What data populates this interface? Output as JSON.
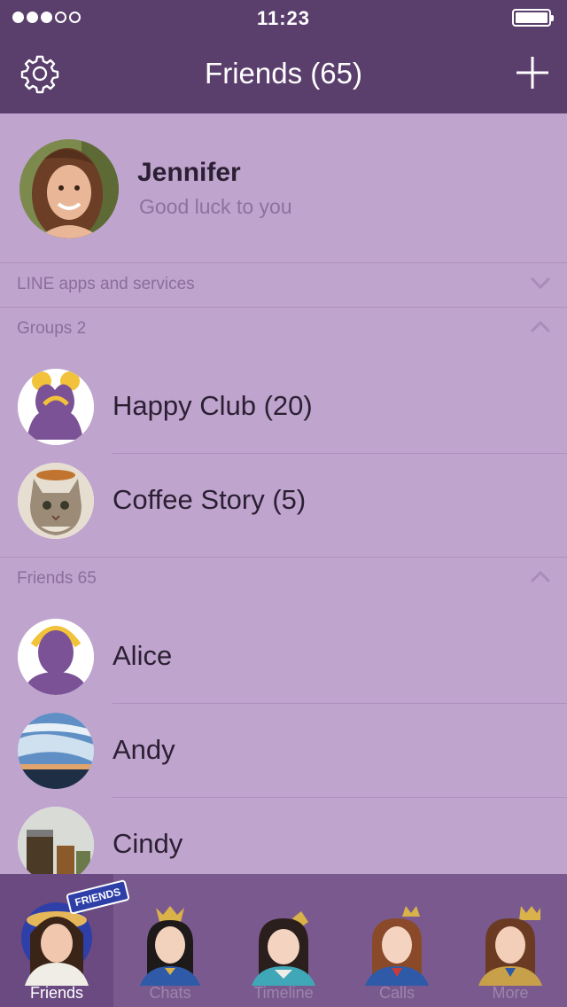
{
  "status_bar": {
    "time": "11:23"
  },
  "header": {
    "title": "Friends (65)"
  },
  "profile": {
    "name": "Jennifer",
    "status_message": "Good luck to you"
  },
  "sections": {
    "services": {
      "label": "LINE apps and services"
    },
    "groups": {
      "label": "Groups 2"
    },
    "friends": {
      "label": "Friends 65"
    }
  },
  "groups": [
    {
      "name": "Happy Club (20)"
    },
    {
      "name": "Coffee Story (5)"
    }
  ],
  "friends": [
    {
      "name": "Alice"
    },
    {
      "name": "Andy"
    },
    {
      "name": "Cindy"
    }
  ],
  "tabbar": {
    "badge": "FRIENDS",
    "tabs": [
      {
        "label": "Friends"
      },
      {
        "label": "Chats"
      },
      {
        "label": "Timeline"
      },
      {
        "label": "Calls"
      },
      {
        "label": "More"
      }
    ]
  },
  "colors": {
    "header": "#5a3e6c",
    "background": "#bfa4cd",
    "tabbar": "#7a5a8e"
  }
}
